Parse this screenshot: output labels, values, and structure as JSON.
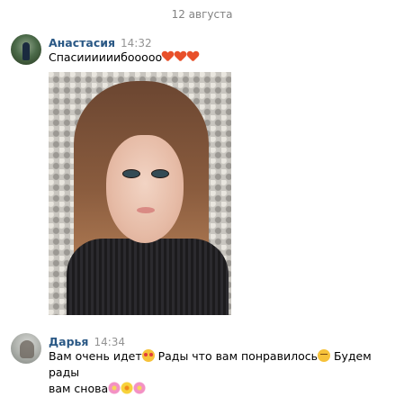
{
  "date_divider": "12 августа",
  "messages": [
    {
      "author": "Анастасия",
      "time": "14:32",
      "text": "Спасиииииибооооо"
    },
    {
      "author": "Дарья",
      "time": "14:34",
      "text_part1": "Вам очень идет",
      "text_part2": " Рады что вам понравилось",
      "text_part3": " Будем рады",
      "text_line2": "вам снова"
    }
  ],
  "colors": {
    "author_link": "#2a5885",
    "timestamp": "#939393",
    "date_divider": "#828282"
  },
  "icons": [
    "orange-heart-icon",
    "smiling-face-with-heart-eyes-icon",
    "relieved-face-icon",
    "cherry-blossom-icon",
    "sunflower-icon"
  ]
}
